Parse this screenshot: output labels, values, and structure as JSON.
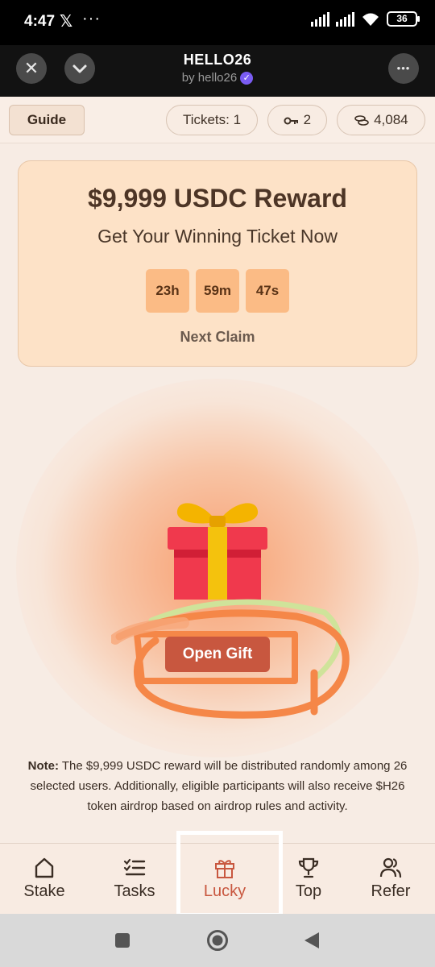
{
  "status_bar": {
    "time": "4:47",
    "x_icon": "𝕏",
    "more": "···",
    "battery": "36"
  },
  "header": {
    "title": "HELLO26",
    "subtitle": "by hello26",
    "close_icon": "✕",
    "chevron_icon": "⌄",
    "more_icon": "•••"
  },
  "top_bar": {
    "guide": "Guide",
    "tickets": "Tickets: 1",
    "keys": "2",
    "coins": "4,084"
  },
  "reward": {
    "title": "$9,999 USDC Reward",
    "subtitle": "Get Your Winning Ticket Now",
    "timer": {
      "hours": "23h",
      "minutes": "59m",
      "seconds": "47s"
    },
    "next_claim": "Next Claim"
  },
  "gift": {
    "button": "Open Gift"
  },
  "note": {
    "label": "Note:",
    "text": " The $9,999 USDC reward will be distributed randomly among 26 selected users. Additionally, eligible participants will also receive $H26 token airdrop based on airdrop rules and activity."
  },
  "nav": [
    {
      "label": "Stake",
      "icon": "home-icon"
    },
    {
      "label": "Tasks",
      "icon": "checklist-icon"
    },
    {
      "label": "Lucky",
      "icon": "gift-icon",
      "active": true
    },
    {
      "label": "Top",
      "icon": "trophy-icon"
    },
    {
      "label": "Refer",
      "icon": "users-icon"
    }
  ],
  "colors": {
    "accent": "#c8573f",
    "card_bg": "#fde2c7",
    "timer_bg": "#fbbb85",
    "page_bg": "#f7ece4"
  }
}
